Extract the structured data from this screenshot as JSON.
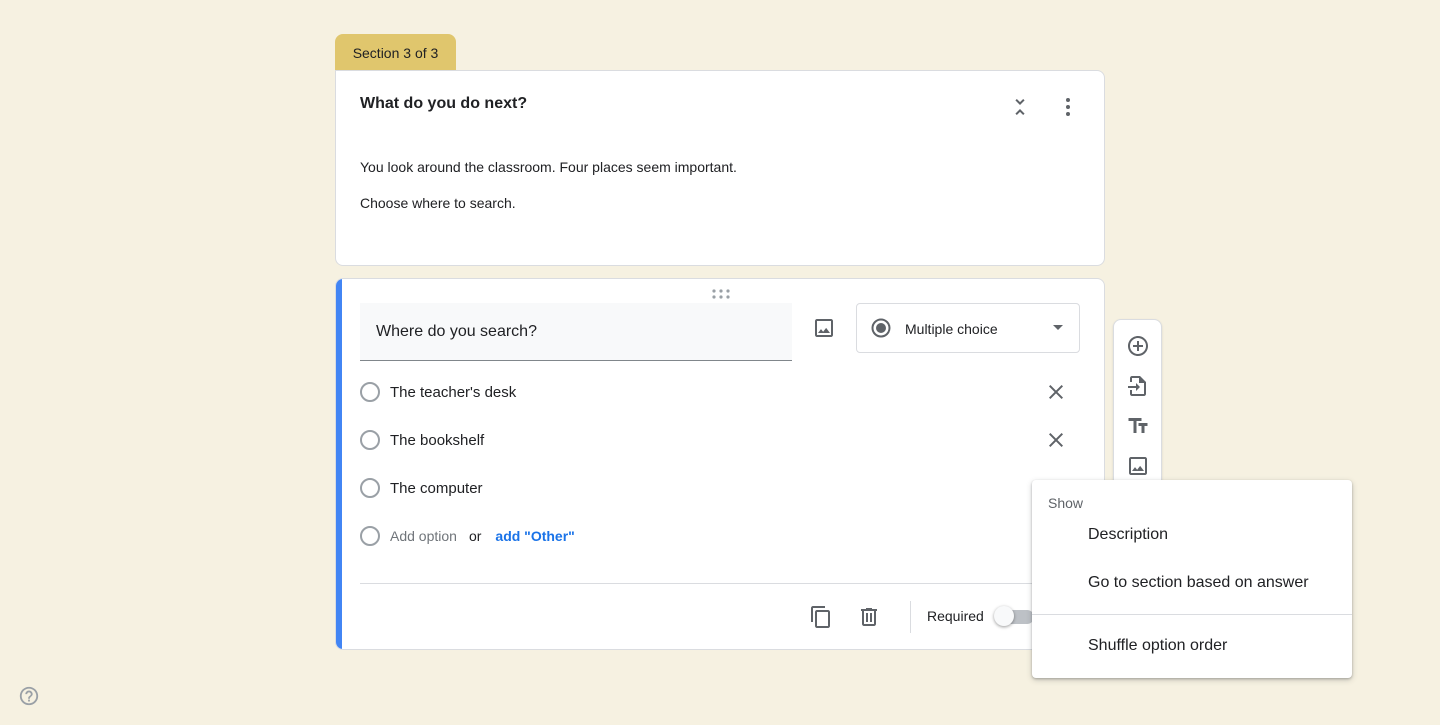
{
  "section": {
    "tab_label": "Section 3 of 3"
  },
  "header": {
    "title": "What do you do next?",
    "description": [
      "You look around the classroom. Four places seem important.",
      "Choose where to search."
    ]
  },
  "question": {
    "title": "Where do you search?",
    "type_label": "Multiple choice",
    "options": [
      "The teacher's desk",
      "The bookshelf",
      "The computer"
    ],
    "add_option_label": "Add option",
    "or_label": "or",
    "add_other_label": "add \"Other\"",
    "required_label": "Required",
    "required": false
  },
  "menu": {
    "header": "Show",
    "items": [
      "Description",
      "Go to section based on answer",
      "Shuffle option order"
    ]
  },
  "colors": {
    "accent": "#4285f4",
    "section_tab": "#e0c66d",
    "link": "#1a73e8",
    "background": "#f6f1e1"
  }
}
